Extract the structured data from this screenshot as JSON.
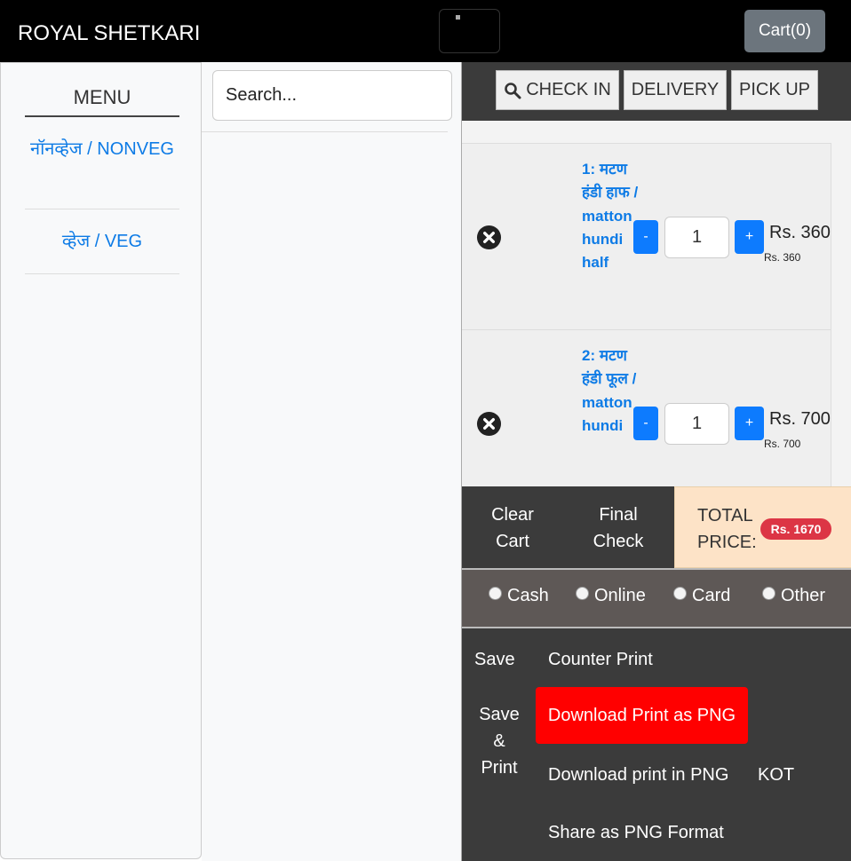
{
  "navbar": {
    "brand": "ROYAL SHETKARI",
    "cart_label": "Cart(0)"
  },
  "menu": {
    "title": "MENU",
    "categories": [
      {
        "label": "नॉनव्हेज / NONVEG"
      },
      {
        "label": "व्हेज / VEG"
      }
    ]
  },
  "search": {
    "placeholder": "Search..."
  },
  "order_types": {
    "check_in": "CHECK IN",
    "delivery": "DELIVERY",
    "pick_up": "PICK UP"
  },
  "cart": {
    "items": [
      {
        "name": "1: मटण हंडी हाफ / matton hundi half",
        "qty": "1",
        "price": "Rs. 360",
        "subtotal": "Rs. 360"
      },
      {
        "name": "2: मटण हंडी फूल / matton hundi",
        "qty": "1",
        "price": "Rs. 700",
        "subtotal": "Rs. 700"
      }
    ],
    "minus_label": "-",
    "plus_label": "+"
  },
  "actions": {
    "clear_cart": "Clear Cart",
    "final_check": "Final Check",
    "total_label": "TOTAL PRICE:",
    "total_value": "Rs. 1670"
  },
  "payment": {
    "options": [
      "Cash",
      "Online",
      "Card",
      "Other"
    ]
  },
  "print": {
    "save": "Save",
    "counter_print": "Counter Print",
    "save_print": "Save & Print",
    "download_png_button": "Download Print as PNG",
    "download_print": "Download print in PNG",
    "kot": "KOT",
    "share_png": "Share as PNG Format"
  },
  "colors": {
    "navbar_bg": "#000000",
    "link_blue": "#0d7be6",
    "total_badge": "#dc3545",
    "download_button": "#ff0000",
    "total_box": "#fde3c7"
  }
}
